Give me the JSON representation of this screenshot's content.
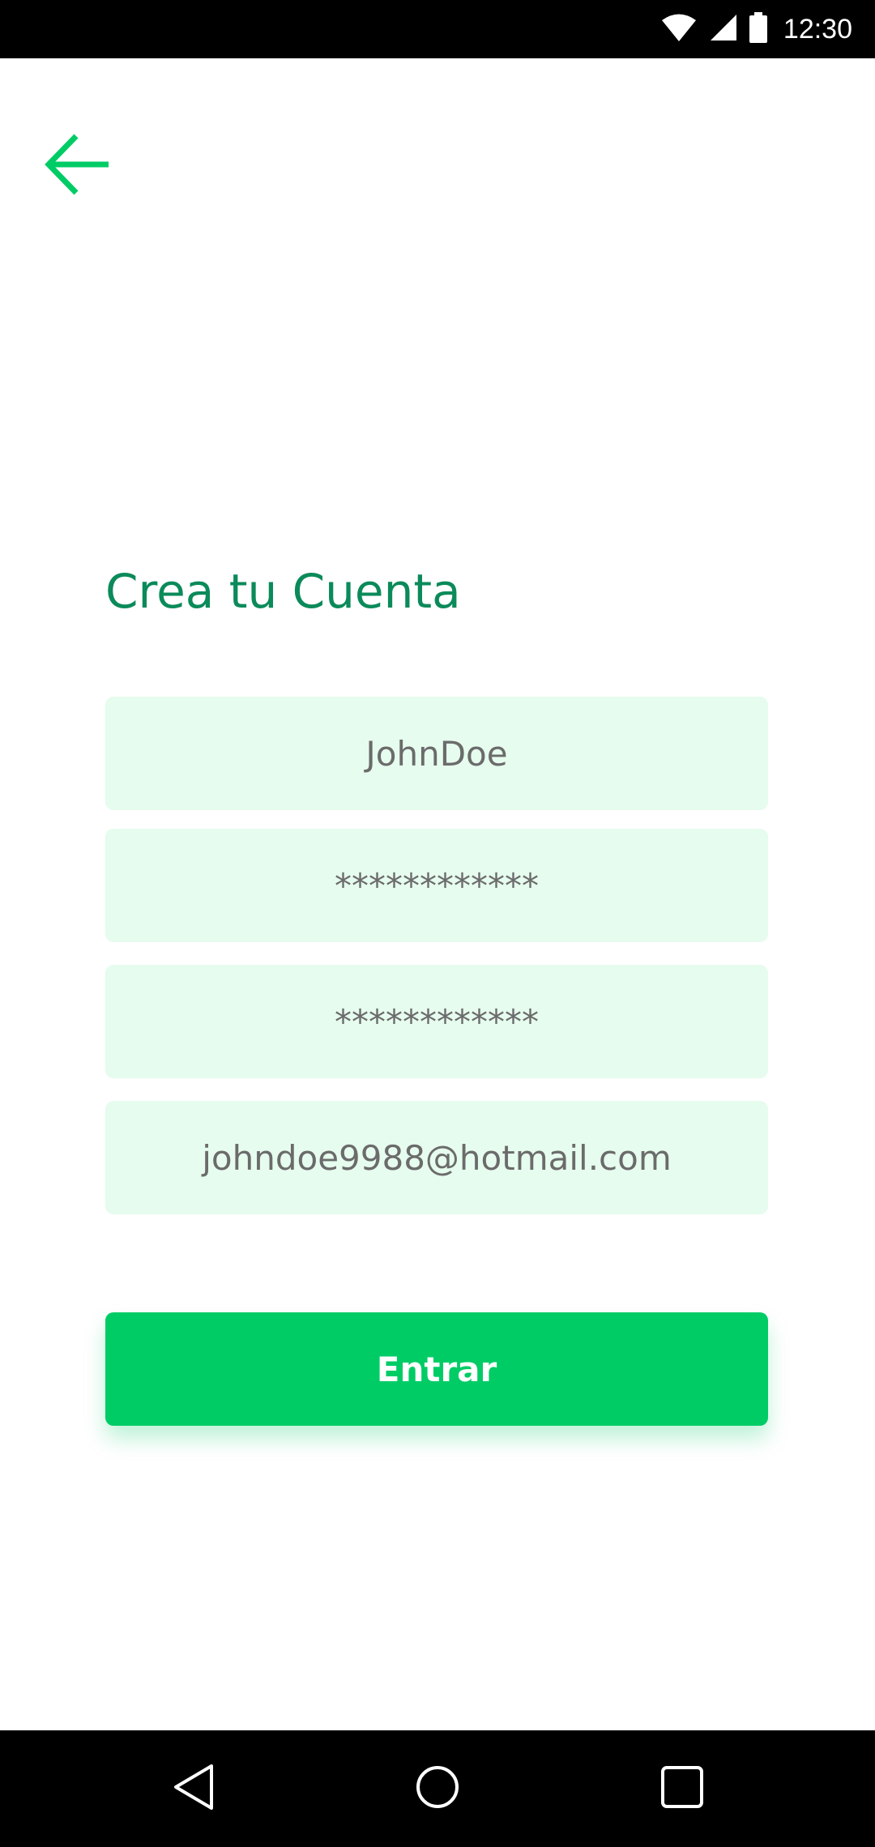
{
  "status_bar": {
    "time": "12:30",
    "icons": [
      "wifi-icon",
      "cell-signal-icon",
      "battery-icon"
    ]
  },
  "header": {
    "back_icon": "arrow-left-icon"
  },
  "form": {
    "title": "Crea tu Cuenta",
    "fields": [
      {
        "name": "username",
        "value": "JohnDoe"
      },
      {
        "name": "password",
        "value": "************"
      },
      {
        "name": "confirm_password",
        "value": "************"
      },
      {
        "name": "email",
        "value": "johndoe9988@hotmail.com"
      }
    ],
    "submit_label": "Entrar"
  },
  "nav_bar": {
    "icons": [
      "nav-back-icon",
      "nav-home-icon",
      "nav-recents-icon"
    ]
  },
  "colors": {
    "accent": "#00cc66",
    "title": "#0b8a5a",
    "field_bg": "#e6fcee",
    "field_text": "#6b6b6b"
  }
}
